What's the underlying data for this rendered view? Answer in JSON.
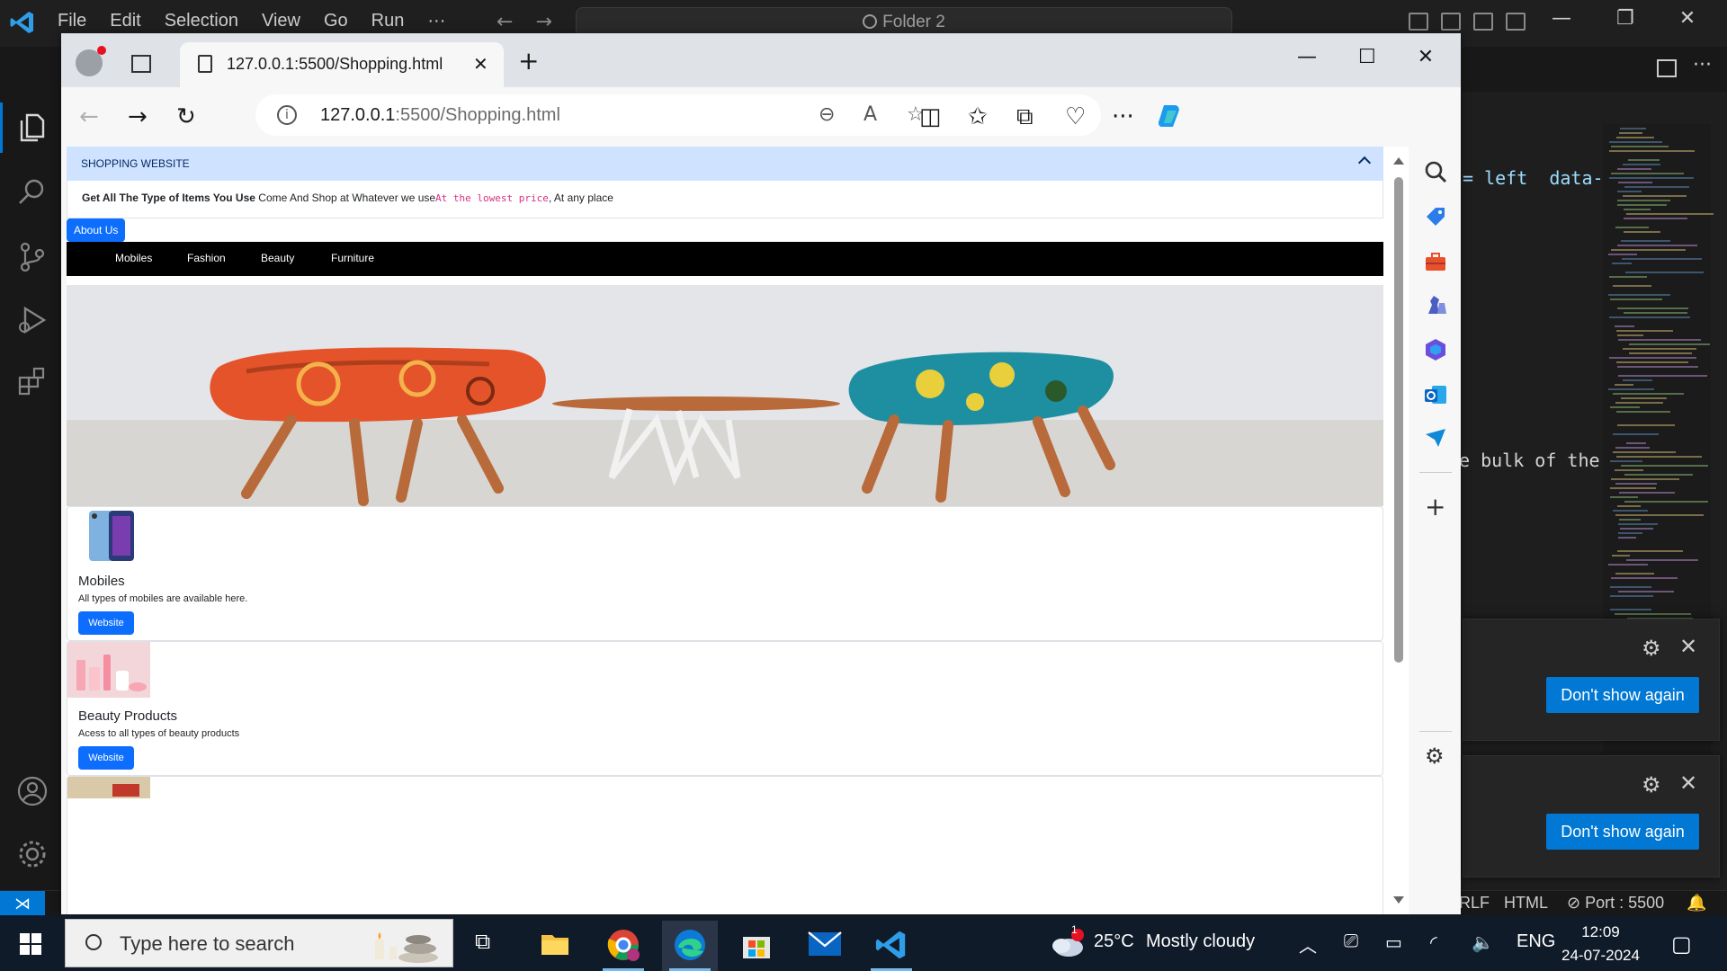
{
  "vscode": {
    "menu": [
      "File",
      "Edit",
      "Selection",
      "View",
      "Go",
      "Run",
      "···"
    ],
    "nav_back": "←",
    "nav_forward": "→",
    "search_label": "Folder 2",
    "code_fragments": [
      "= left  data-b",
      "e bulk of the"
    ],
    "status": {
      "crlf": "RLF",
      "language": "HTML",
      "port": "Port : 5500",
      "bell": "🔔"
    },
    "notifications": [
      {
        "button": "Don't show again"
      },
      {
        "button": "Don't show again"
      }
    ]
  },
  "edge": {
    "tab_title": "127.0.0.1:5500/Shopping.html",
    "url_host": "127.0.0.1",
    "url_rest": ":5500/Shopping.html"
  },
  "page": {
    "accordion_header": "SHOPPING WEBSITE",
    "accordion_body_bold": "Get All The Type of Items You Use",
    "accordion_body_text": " Come And Shop at Whatever we use",
    "accordion_body_code": "At the lowest price",
    "accordion_body_tail": ", At any place",
    "about_button": "About Us",
    "nav_items": [
      "Mobiles",
      "Fashion",
      "Beauty",
      "Furniture"
    ],
    "cards": [
      {
        "title": "Mobiles",
        "text": "All types of mobiles are available here.",
        "button": "Website"
      },
      {
        "title": "Beauty Products",
        "text": "Acess to all types of beauty products",
        "button": "Website"
      }
    ]
  },
  "taskbar": {
    "search_placeholder": "Type here to search",
    "weather_temp": "25°C",
    "weather_desc": "Mostly cloudy",
    "weather_badge": "1",
    "language": "ENG",
    "time": "12:09",
    "date": "24-07-2024"
  }
}
